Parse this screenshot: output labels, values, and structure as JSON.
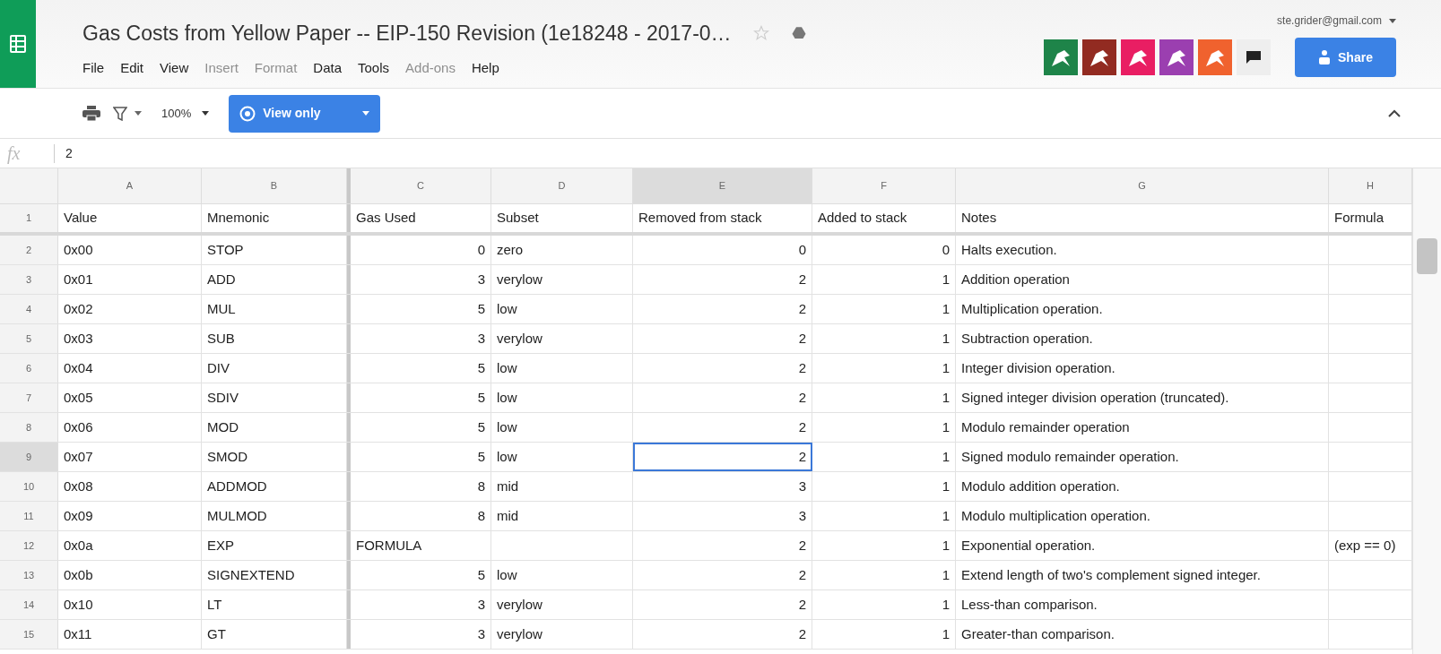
{
  "document": {
    "title": "Gas Costs from Yellow Paper -- EIP-150 Revision (1e18248 - 2017-0…",
    "account": "ste.grider@gmail.com"
  },
  "menu": [
    {
      "label": "File",
      "disabled": false
    },
    {
      "label": "Edit",
      "disabled": false
    },
    {
      "label": "View",
      "disabled": false
    },
    {
      "label": "Insert",
      "disabled": true
    },
    {
      "label": "Format",
      "disabled": true
    },
    {
      "label": "Data",
      "disabled": false
    },
    {
      "label": "Tools",
      "disabled": false
    },
    {
      "label": "Add-ons",
      "disabled": true
    },
    {
      "label": "Help",
      "disabled": false
    }
  ],
  "viewers": [
    {
      "color": "#1e8449"
    },
    {
      "color": "#922b21"
    },
    {
      "color": "#e91e63"
    },
    {
      "color": "#9b3fb0"
    },
    {
      "color": "#f0622e"
    }
  ],
  "share_button": "Share",
  "toolbar": {
    "zoom": "100%",
    "mode_button": "View only"
  },
  "formula_bar": {
    "label": "fx",
    "value": "2"
  },
  "columns": [
    {
      "letter": "A",
      "selected": false
    },
    {
      "letter": "B",
      "selected": false
    },
    {
      "letter": "C",
      "selected": false
    },
    {
      "letter": "D",
      "selected": false
    },
    {
      "letter": "E",
      "selected": true
    },
    {
      "letter": "F",
      "selected": false
    },
    {
      "letter": "G",
      "selected": false
    },
    {
      "letter": "H",
      "selected": false
    }
  ],
  "rows": [
    {
      "number": "1",
      "selected": false,
      "cells": [
        {
          "kind": "text",
          "text": "Value"
        },
        {
          "kind": "text",
          "text": "Mnemonic"
        },
        {
          "kind": "text",
          "text": "Gas Used"
        },
        {
          "kind": "text",
          "text": "Subset"
        },
        {
          "kind": "text",
          "text": "Removed from stack"
        },
        {
          "kind": "text",
          "text": "Added to stack"
        },
        {
          "kind": "text",
          "text": "Notes"
        },
        {
          "kind": "text",
          "text": "Formula"
        }
      ]
    },
    {
      "number": "2",
      "selected": false,
      "cells": [
        {
          "kind": "text",
          "text": "0x00"
        },
        {
          "kind": "text",
          "text": "STOP"
        },
        {
          "kind": "number",
          "text": "0"
        },
        {
          "kind": "text",
          "text": "zero"
        },
        {
          "kind": "number",
          "text": "0"
        },
        {
          "kind": "number",
          "text": "0"
        },
        {
          "kind": "text",
          "text": "Halts execution."
        },
        {
          "kind": "empty"
        }
      ]
    },
    {
      "number": "3",
      "selected": false,
      "cells": [
        {
          "kind": "text",
          "text": "0x01"
        },
        {
          "kind": "text",
          "text": "ADD"
        },
        {
          "kind": "number",
          "text": "3"
        },
        {
          "kind": "text",
          "text": "verylow"
        },
        {
          "kind": "number",
          "text": "2"
        },
        {
          "kind": "number",
          "text": "1"
        },
        {
          "kind": "text",
          "text": "Addition operation"
        },
        {
          "kind": "empty"
        }
      ]
    },
    {
      "number": "4",
      "selected": false,
      "cells": [
        {
          "kind": "text",
          "text": "0x02"
        },
        {
          "kind": "text",
          "text": "MUL"
        },
        {
          "kind": "number",
          "text": "5"
        },
        {
          "kind": "text",
          "text": "low"
        },
        {
          "kind": "number",
          "text": "2"
        },
        {
          "kind": "number",
          "text": "1"
        },
        {
          "kind": "text",
          "text": "Multiplication operation."
        },
        {
          "kind": "empty"
        }
      ]
    },
    {
      "number": "5",
      "selected": false,
      "cells": [
        {
          "kind": "text",
          "text": "0x03"
        },
        {
          "kind": "text",
          "text": "SUB"
        },
        {
          "kind": "number",
          "text": "3"
        },
        {
          "kind": "text",
          "text": "verylow"
        },
        {
          "kind": "number",
          "text": "2"
        },
        {
          "kind": "number",
          "text": "1"
        },
        {
          "kind": "text",
          "text": "Subtraction operation."
        },
        {
          "kind": "empty"
        }
      ]
    },
    {
      "number": "6",
      "selected": false,
      "cells": [
        {
          "kind": "text",
          "text": "0x04"
        },
        {
          "kind": "text",
          "text": "DIV"
        },
        {
          "kind": "number",
          "text": "5"
        },
        {
          "kind": "text",
          "text": "low"
        },
        {
          "kind": "number",
          "text": "2"
        },
        {
          "kind": "number",
          "text": "1"
        },
        {
          "kind": "text",
          "text": "Integer division operation."
        },
        {
          "kind": "empty"
        }
      ]
    },
    {
      "number": "7",
      "selected": false,
      "cells": [
        {
          "kind": "text",
          "text": "0x05"
        },
        {
          "kind": "text",
          "text": "SDIV"
        },
        {
          "kind": "number",
          "text": "5"
        },
        {
          "kind": "text",
          "text": "low"
        },
        {
          "kind": "number",
          "text": "2"
        },
        {
          "kind": "number",
          "text": "1"
        },
        {
          "kind": "text",
          "text": "Signed integer division operation (truncated)."
        },
        {
          "kind": "empty"
        }
      ]
    },
    {
      "number": "8",
      "selected": false,
      "cells": [
        {
          "kind": "text",
          "text": "0x06"
        },
        {
          "kind": "text",
          "text": "MOD"
        },
        {
          "kind": "number",
          "text": "5"
        },
        {
          "kind": "text",
          "text": "low"
        },
        {
          "kind": "number",
          "text": "2"
        },
        {
          "kind": "number",
          "text": "1"
        },
        {
          "kind": "text",
          "text": "Modulo remainder operation"
        },
        {
          "kind": "empty"
        }
      ]
    },
    {
      "number": "9",
      "selected": true,
      "cells": [
        {
          "kind": "text",
          "text": "0x07"
        },
        {
          "kind": "text",
          "text": "SMOD"
        },
        {
          "kind": "number",
          "text": "5"
        },
        {
          "kind": "text",
          "text": "low"
        },
        {
          "kind": "number",
          "text": "2"
        },
        {
          "kind": "number",
          "text": "1"
        },
        {
          "kind": "text",
          "text": "Signed modulo remainder operation."
        },
        {
          "kind": "empty"
        }
      ]
    },
    {
      "number": "10",
      "selected": false,
      "cells": [
        {
          "kind": "text",
          "text": "0x08"
        },
        {
          "kind": "text",
          "text": "ADDMOD"
        },
        {
          "kind": "number",
          "text": "8"
        },
        {
          "kind": "text",
          "text": "mid"
        },
        {
          "kind": "number",
          "text": "3"
        },
        {
          "kind": "number",
          "text": "1"
        },
        {
          "kind": "text",
          "text": "Modulo addition operation."
        },
        {
          "kind": "empty"
        }
      ]
    },
    {
      "number": "11",
      "selected": false,
      "cells": [
        {
          "kind": "text",
          "text": "0x09"
        },
        {
          "kind": "text",
          "text": "MULMOD"
        },
        {
          "kind": "number",
          "text": "8"
        },
        {
          "kind": "text",
          "text": "mid"
        },
        {
          "kind": "number",
          "text": "3"
        },
        {
          "kind": "number",
          "text": "1"
        },
        {
          "kind": "text",
          "text": "Modulo multiplication operation."
        },
        {
          "kind": "empty"
        }
      ]
    },
    {
      "number": "12",
      "selected": false,
      "cells": [
        {
          "kind": "text",
          "text": "0x0a"
        },
        {
          "kind": "text",
          "text": "EXP"
        },
        {
          "kind": "text",
          "text": "FORMULA"
        },
        {
          "kind": "empty"
        },
        {
          "kind": "number",
          "text": "2"
        },
        {
          "kind": "number",
          "text": "1"
        },
        {
          "kind": "text",
          "text": "Exponential operation."
        },
        {
          "kind": "text",
          "text": "(exp == 0)"
        }
      ]
    },
    {
      "number": "13",
      "selected": false,
      "cells": [
        {
          "kind": "text",
          "text": "0x0b"
        },
        {
          "kind": "text",
          "text": "SIGNEXTEND"
        },
        {
          "kind": "number",
          "text": "5"
        },
        {
          "kind": "text",
          "text": "low"
        },
        {
          "kind": "number",
          "text": "2"
        },
        {
          "kind": "number",
          "text": "1"
        },
        {
          "kind": "text",
          "text": "Extend length of two's complement signed integer."
        },
        {
          "kind": "empty"
        }
      ]
    },
    {
      "number": "14",
      "selected": false,
      "cells": [
        {
          "kind": "text",
          "text": "0x10"
        },
        {
          "kind": "text",
          "text": "LT"
        },
        {
          "kind": "number",
          "text": "3"
        },
        {
          "kind": "text",
          "text": "verylow"
        },
        {
          "kind": "number",
          "text": "2"
        },
        {
          "kind": "number",
          "text": "1"
        },
        {
          "kind": "text",
          "text": "Less-than comparison."
        },
        {
          "kind": "empty"
        }
      ]
    },
    {
      "number": "15",
      "selected": false,
      "cells": [
        {
          "kind": "text",
          "text": "0x11"
        },
        {
          "kind": "text",
          "text": "GT"
        },
        {
          "kind": "number",
          "text": "3"
        },
        {
          "kind": "text",
          "text": "verylow"
        },
        {
          "kind": "number",
          "text": "2"
        },
        {
          "kind": "number",
          "text": "1"
        },
        {
          "kind": "text",
          "text": "Greater-than comparison."
        },
        {
          "kind": "empty"
        }
      ]
    }
  ]
}
